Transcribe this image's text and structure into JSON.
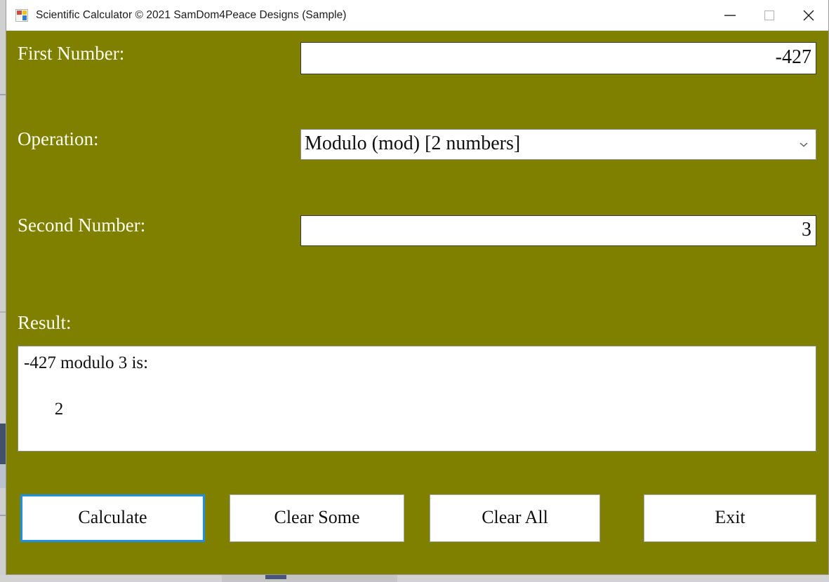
{
  "window": {
    "title": "Scientific Calculator © 2021 SamDom4Peace Designs (Sample)",
    "icon": "app-form-icon",
    "background_color": "#808000",
    "controls": {
      "minimize": "minimize-icon",
      "maximize": "maximize-icon",
      "close": "close-icon"
    }
  },
  "form": {
    "first_number": {
      "label": "First Number:",
      "value": "-427",
      "placeholder": ""
    },
    "operation": {
      "label": "Operation:",
      "selected": "Modulo (mod) [2 numbers]",
      "arrow_icon": "chevron-down-icon"
    },
    "second_number": {
      "label": "Second Number:",
      "value": "3",
      "placeholder": ""
    },
    "result": {
      "label": "Result:",
      "text": "-427 modulo 3 is:\n\n       2"
    }
  },
  "buttons": {
    "calculate": "Calculate",
    "clear_some": "Clear Some",
    "clear_all": "Clear All",
    "exit": "Exit",
    "focused": "Calculate",
    "focus_color": "#1c8fe8"
  }
}
